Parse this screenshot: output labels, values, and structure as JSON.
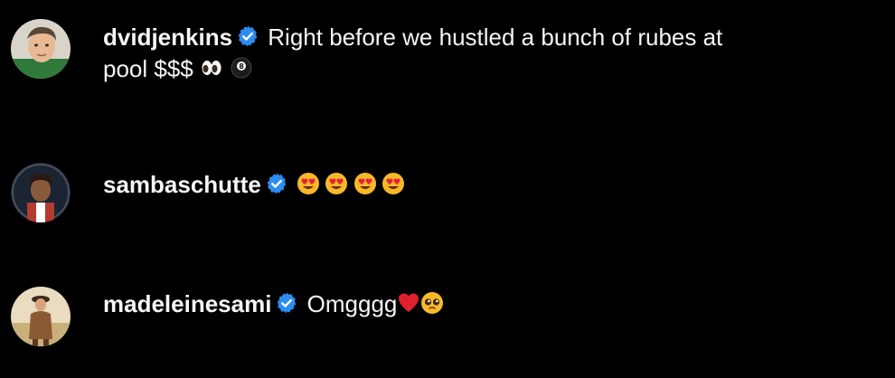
{
  "colors": {
    "background": "#000000",
    "text": "#f5f5f5",
    "verified_badge": "#2d8cf0"
  },
  "comments": [
    {
      "username": "dvidjenkins",
      "verified": true,
      "text_line1": "Right before we hustled a bunch of rubes at",
      "text_line2": "pool $$$",
      "emojis": [
        "eyes-emoji",
        "8-ball-emoji"
      ]
    },
    {
      "username": "sambaschutte",
      "verified": true,
      "text": "",
      "emojis": [
        "heart-eyes-emoji",
        "heart-eyes-emoji",
        "heart-eyes-emoji",
        "heart-eyes-emoji"
      ]
    },
    {
      "username": "madeleinesami",
      "verified": true,
      "text": "Omgggg",
      "emojis": [
        "red-heart-emoji",
        "pleading-face-emoji"
      ]
    }
  ]
}
